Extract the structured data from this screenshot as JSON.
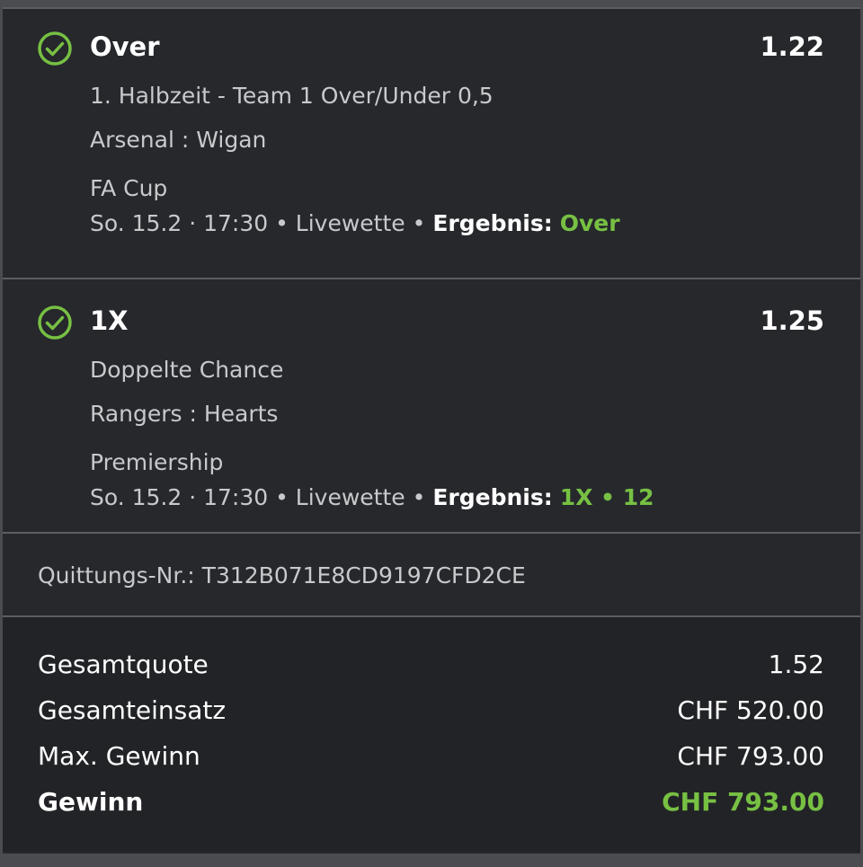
{
  "bets": [
    {
      "pick": "Over",
      "odds": "1.22",
      "market": "1. Halbzeit - Team 1 Over/Under 0,5",
      "match": "Arsenal : Wigan",
      "competition": "FA Cup",
      "datetime": "So. 15.2 · 17:30 • Livewette •",
      "result_label": "Ergebnis:",
      "result_value": "Over",
      "status_icon": "check-circle-icon"
    },
    {
      "pick": "1X",
      "odds": "1.25",
      "market": "Doppelte Chance",
      "match": "Rangers : Hearts",
      "competition": "Premiership",
      "datetime": "So. 15.2 · 17:30 • Livewette •",
      "result_label": "Ergebnis:",
      "result_value": "1X • 12",
      "status_icon": "check-circle-icon"
    }
  ],
  "receipt": {
    "text": "Quittungs-Nr.: T312B071E8CD9197CFD2CE"
  },
  "summary": {
    "total_odds_label": "Gesamtquote",
    "total_odds_value": "1.52",
    "total_stake_label": "Gesamteinsatz",
    "total_stake_value": "CHF 520.00",
    "max_win_label": "Max. Gewinn",
    "max_win_value": "CHF 793.00",
    "win_label": "Gewinn",
    "win_value": "CHF 793.00"
  },
  "colors": {
    "accent_green": "#77c043",
    "panel_bg": "#26282c",
    "summary_bg": "#222326"
  }
}
